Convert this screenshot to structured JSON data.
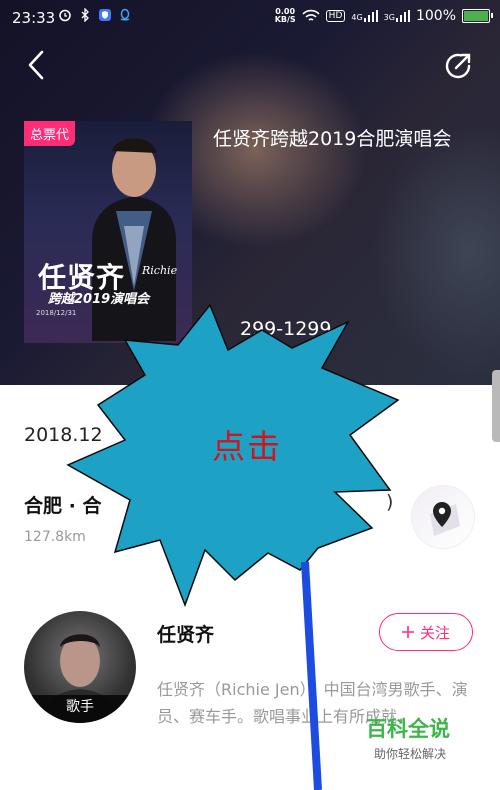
{
  "status_bar": {
    "time": "23:33",
    "net_speed_value": "0.00",
    "net_speed_unit": "KB/S",
    "hd": "HD",
    "signal_4g": "4G",
    "signal_3g": "3G",
    "battery_text": "100%",
    "battery_level": 1.0,
    "battery_color": "#4caf50"
  },
  "header": {
    "back_icon": "chevron-left-icon",
    "share_icon": "share-icon"
  },
  "event": {
    "badge": "总票代",
    "title": "任贤齐跨越2019合肥演唱会",
    "price": "299-1299",
    "date": "2018.12",
    "city": "合肥 · 合",
    "paren": ")",
    "distance": "127.8km"
  },
  "poster": {
    "name": "任贤齐",
    "eng_name": "Richie",
    "subtitle": "跨越2019演唱会",
    "date_line": "2018/12/31"
  },
  "artist": {
    "name": "任贤齐",
    "avatar_label": "歌手",
    "follow_label": "关注",
    "bio": "任贤齐（Richie Jen），中国台湾男歌手、演员、赛车手。歌唱事业上有所成就，"
  },
  "overlay": {
    "click_label": "点击",
    "burst_color": "#1da2c6",
    "arrow_color": "#1d4ce0"
  },
  "watermark": {
    "main": "百科全说",
    "sub": "助你轻松解决"
  },
  "colors": {
    "accent": "#ff2c76"
  }
}
